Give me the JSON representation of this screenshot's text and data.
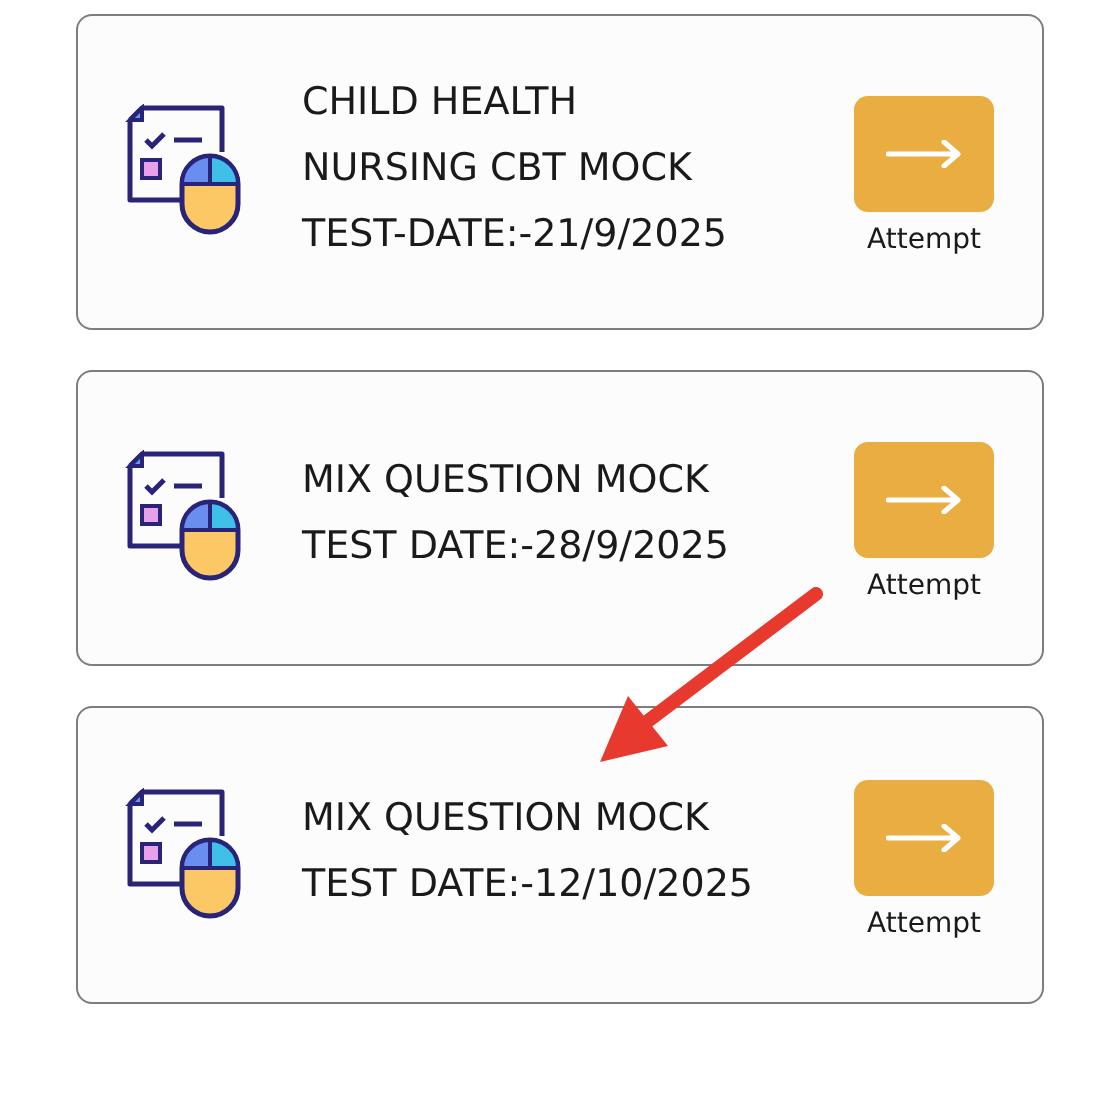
{
  "tests": [
    {
      "title_lines": [
        "CHILD HEALTH",
        "NURSING CBT MOCK",
        "TEST-DATE:-21/9/2025"
      ],
      "button_label": "Attempt"
    },
    {
      "title_lines": [
        "MIX QUESTION MOCK",
        "TEST DATE:-28/9/2025"
      ],
      "button_label": "Attempt"
    },
    {
      "title_lines": [
        "MIX QUESTION MOCK",
        "TEST DATE:-12/10/2025"
      ],
      "button_label": "Attempt"
    }
  ]
}
